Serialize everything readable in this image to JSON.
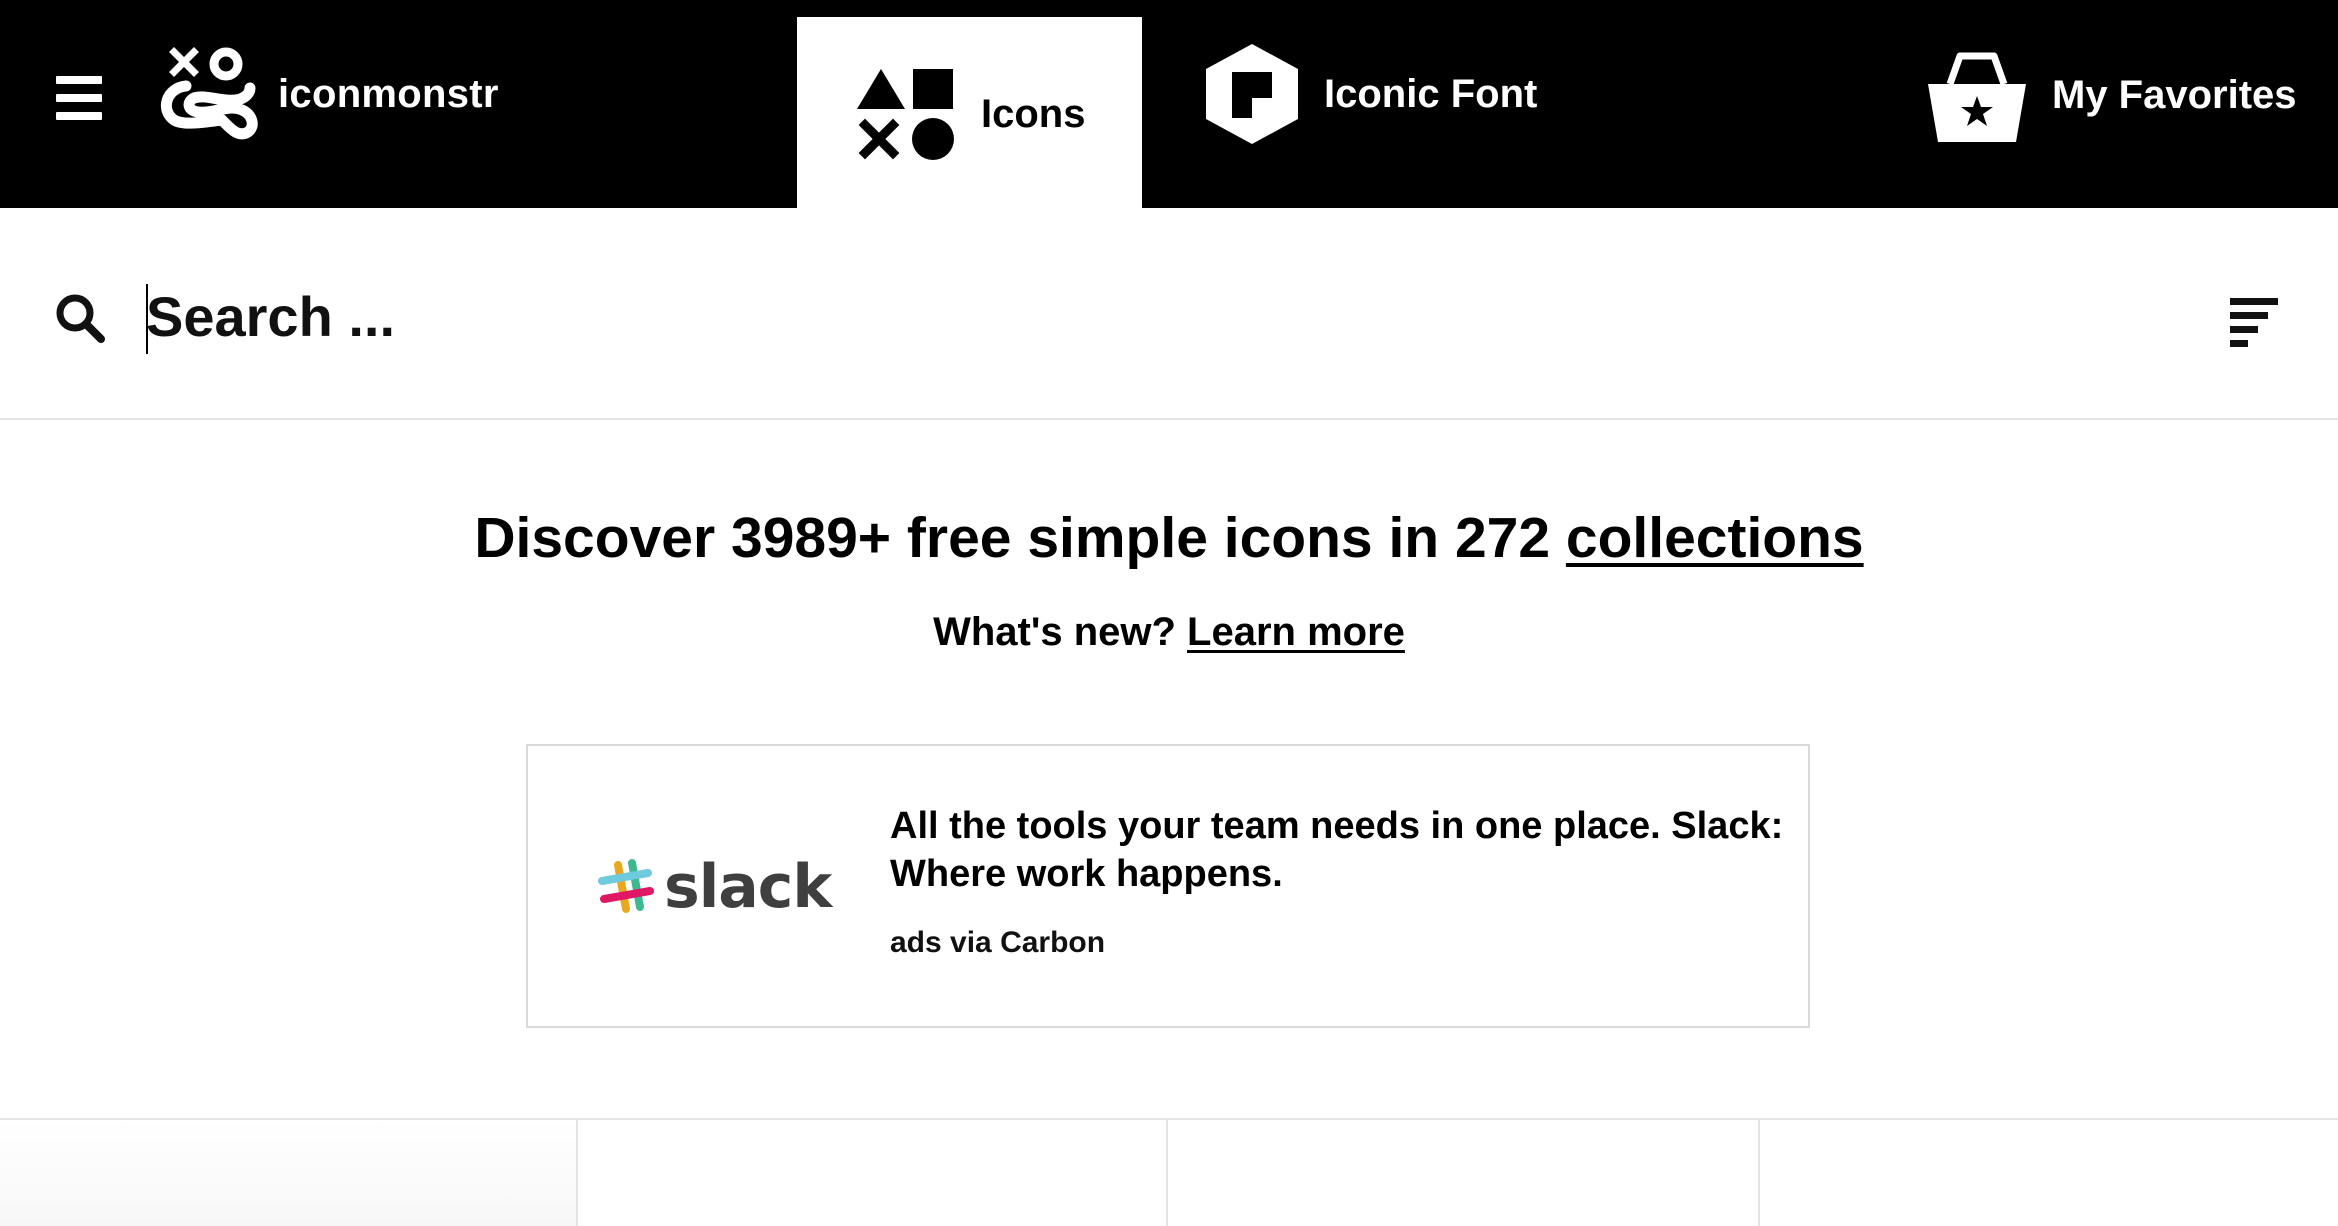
{
  "nav": {
    "brand": "iconmonstr",
    "tabs": [
      {
        "label": "Icons",
        "active": true
      },
      {
        "label": "Iconic Font",
        "active": false
      },
      {
        "label": "My Favorites",
        "active": false
      }
    ]
  },
  "search": {
    "placeholder": "Search ..."
  },
  "hero": {
    "title_prefix": "Discover 3989+ free simple icons in 272 ",
    "title_link": "collections",
    "sub_prefix": "What's new? ",
    "sub_link": "Learn more"
  },
  "ad": {
    "logo_word": "slack",
    "text": "All the tools your team needs in one place. Slack: Where work happens.",
    "via": "ads via Carbon"
  },
  "colors": {
    "nav_bg": "#000000",
    "active_tab_bg": "#ffffff",
    "divider": "#e3e3e3"
  }
}
